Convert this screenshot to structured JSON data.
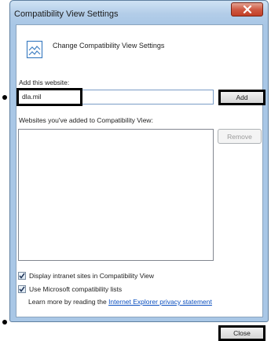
{
  "window": {
    "title": "Compatibility View Settings",
    "close_glyph": "✕"
  },
  "header": {
    "icon": "compatibility-view-icon",
    "text": "Change Compatibility View Settings"
  },
  "add_site": {
    "label": "Add this website:",
    "value": "dla.mil",
    "button_label": "Add"
  },
  "site_list": {
    "label": "Websites you've added to Compatibility View:",
    "items": [],
    "remove_label": "Remove"
  },
  "options": [
    {
      "label": "Display intranet sites in Compatibility View",
      "checked": true
    },
    {
      "label": "Use Microsoft compatibility lists",
      "checked": true
    }
  ],
  "privacy": {
    "prefix": "Learn more by reading the ",
    "link_text": "Internet Explorer privacy statement"
  },
  "footer": {
    "close_label": "Close"
  },
  "colors": {
    "frame": "#a9c7e6",
    "link": "#0b4fbf",
    "close_button": "#c33f26"
  }
}
